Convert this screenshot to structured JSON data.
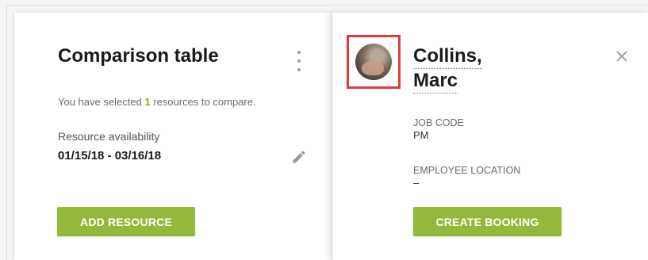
{
  "comparison": {
    "title": "Comparison table",
    "selected_prefix": "You have selected ",
    "selected_count": "1",
    "selected_suffix": " resources to compare.",
    "availability_label": "Resource availability",
    "availability_dates": "01/15/18 - 03/16/18",
    "add_resource_label": "ADD RESOURCE"
  },
  "resource": {
    "last_name": "Collins,",
    "first_name": "Marc",
    "job_code_label": "JOB CODE",
    "job_code_value": "PM",
    "location_label": "EMPLOYEE LOCATION",
    "location_value": "–",
    "create_booking_label": "CREATE BOOKING"
  },
  "colors": {
    "accent_green": "#94b93a",
    "count_green": "#7cab2a",
    "highlight_red": "#e23b3b"
  },
  "icons": {
    "menu": "kebab-menu-icon",
    "edit": "pencil-icon",
    "close": "close-icon"
  }
}
